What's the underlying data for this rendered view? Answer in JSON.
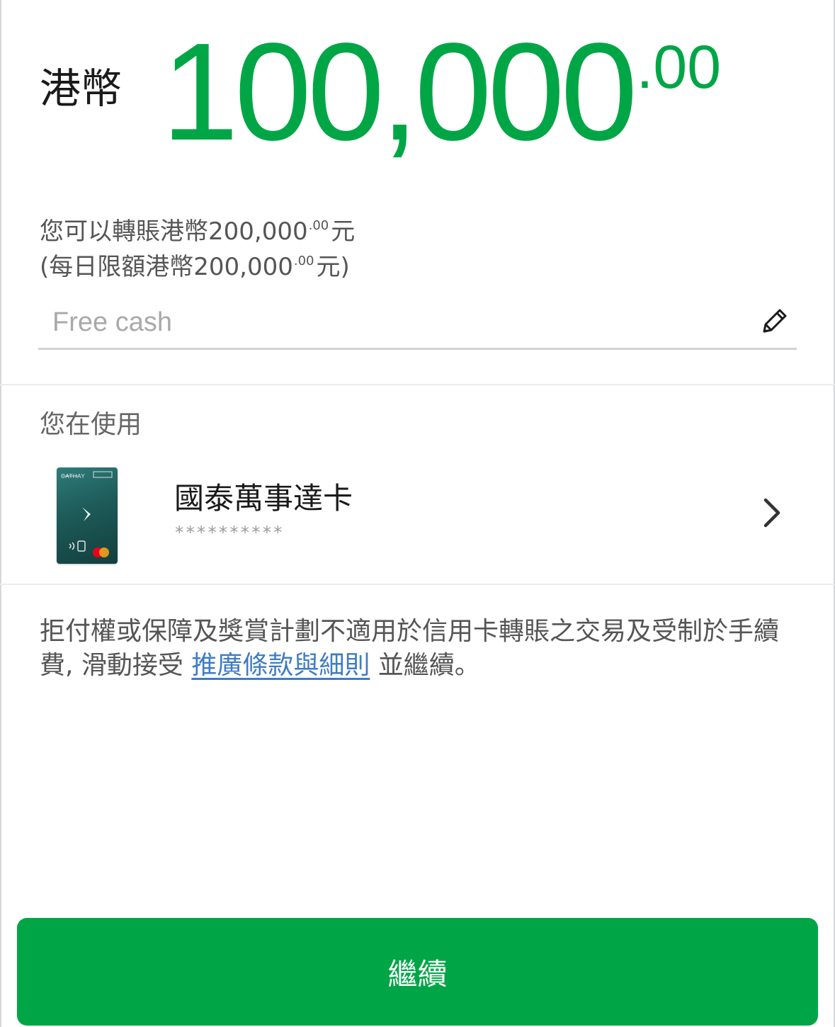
{
  "amount": {
    "currency": "港幣",
    "integer": "100,000",
    "decimal": ".00",
    "color": "#00a646"
  },
  "limits": {
    "line1_prefix": "您可以轉賬港幣200,000",
    "line1_decimal": ".00",
    "line1_suffix": "元",
    "line2_prefix": "(每日限額港幣200,000",
    "line2_decimal": ".00",
    "line2_suffix": "元)"
  },
  "memo": {
    "value": "Free cash",
    "icon": "pencil-icon"
  },
  "payment_method": {
    "section_label": "您在使用",
    "card_name": "國泰萬事達卡",
    "card_number_masked": "**********",
    "card_brand_text": "CATHAY",
    "chevron_icon": "chevron-right-icon"
  },
  "disclaimer": {
    "text_before": "拒付權或保障及獎賞計劃不適用於信用卡轉賬之交易及受制於手續費, 滑動接受 ",
    "link_text": "推廣條款與細則",
    "text_after": " 並繼續。",
    "link_color": "#3f7cc4"
  },
  "continue_button": {
    "label": "繼續",
    "color": "#00a646"
  }
}
